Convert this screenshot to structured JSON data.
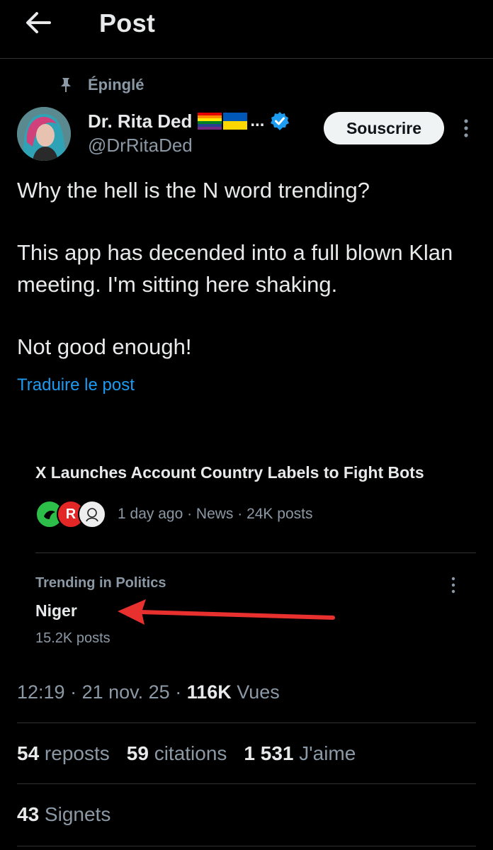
{
  "header": {
    "title": "Post",
    "back_icon": "arrow-left-icon"
  },
  "pinned": {
    "label": "Épinglé",
    "icon": "pin-icon"
  },
  "author": {
    "display_name": "Dr. Rita Ded",
    "name_suffix": "...",
    "handle": "@DrRitaDed",
    "verified_color": "#1d9bf0",
    "flags": [
      "rainbow-flag",
      "ukraine-flag"
    ]
  },
  "actions": {
    "subscribe_label": "Souscrire",
    "more_icon": "more-vertical-icon"
  },
  "post": {
    "paragraphs": [
      "Why the hell is the N word trending?",
      "This app has decended into a full blown Klan meeting. I'm sitting here shaking.",
      "Not good enough!"
    ],
    "translate_label": "Traduire le post"
  },
  "news": {
    "title": "X Launches Account Country Labels to Fight Bots",
    "meta": "1 day ago · News · 24K posts"
  },
  "trend": {
    "category": "Trending in Politics",
    "name": "Niger",
    "count": "15.2K posts",
    "annotation_color": "#e8302e"
  },
  "meta": {
    "time": "12:19",
    "sep1": " · ",
    "date": "21 nov. 25",
    "sep2": " · ",
    "views": "116K",
    "views_label": " Vues"
  },
  "stats": {
    "reposts_count": "54",
    "reposts_label": " reposts",
    "quotes_count": "59",
    "quotes_label": " citations",
    "likes_count": "1 531",
    "likes_label": " J'aime",
    "bookmarks_count": "43",
    "bookmarks_label": " Signets"
  },
  "colors": {
    "background": "#000000",
    "text": "#e7e9ea",
    "secondary": "#8b98a5",
    "link": "#1d9bf0",
    "divider": "#2f3336"
  }
}
